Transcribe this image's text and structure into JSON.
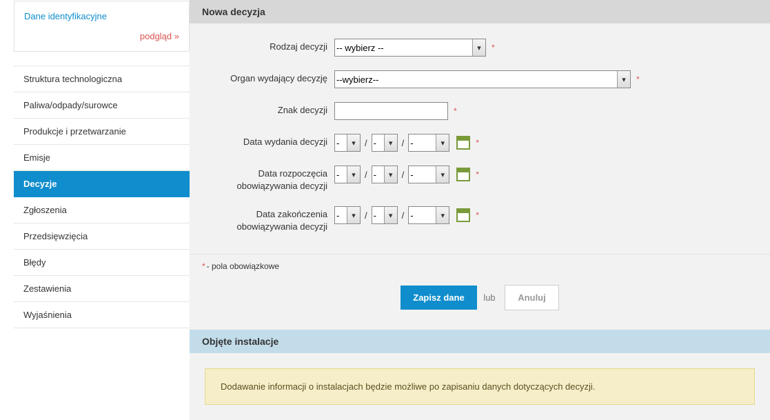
{
  "sidebar": {
    "id_title": "Dane identyfikacyjne",
    "preview_label": "podgląd »",
    "nav": [
      "Struktura technologiczna",
      "Paliwa/odpady/surowce",
      "Produkcje i przetwarzanie",
      "Emisje",
      "Decyzje",
      "Zgłoszenia",
      "Przedsięwzięcia",
      "Błędy",
      "Zestawienia",
      "Wyjaśnienia"
    ],
    "active_index": 4
  },
  "form": {
    "title": "Nowa decyzja",
    "labels": {
      "rodzaj": "Rodzaj decyzji",
      "organ": "Organ wydający decyzję",
      "znak": "Znak decyzji",
      "data_wydania": "Data wydania decyzji",
      "data_rozpoczecia": "Data rozpoczęcia obowiązywania decyzji",
      "data_zakonczenia": "Data zakończenia obowiązywania decyzji"
    },
    "select_placeholder_rodzaj": "-- wybierz --",
    "select_placeholder_organ": "--wybierz--",
    "date_placeholder": "-",
    "required_note": "- pola obowiązkowe",
    "btn_save": "Zapisz dane",
    "btn_or": "lub",
    "btn_cancel": "Anuluj"
  },
  "section2": {
    "title": "Objęte instalacje",
    "info": "Dodawanie informacji o instalacjach będzie możliwe po zapisaniu danych dotyczących decyzji."
  }
}
